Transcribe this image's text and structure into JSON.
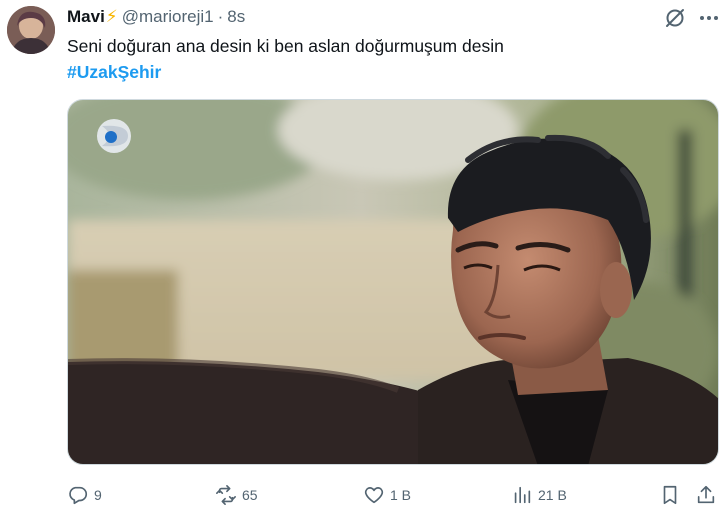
{
  "tweet": {
    "display_name": "Mavi",
    "name_emoji": "⚡",
    "handle": "@marioreji1",
    "separator": "·",
    "time": "8s",
    "text": "Seni doğuran ana desin ki ben aslan doğurmuşum desin",
    "hashtag": "#UzakŞehir"
  },
  "actions": {
    "reply_count": "9",
    "retweet_count": "65",
    "like_count": "1 B",
    "views_count": "21 B"
  },
  "icons": {
    "reply": "reply-icon",
    "retweet": "retweet-icon",
    "like": "heart-icon",
    "views": "views-chart-icon",
    "bookmark": "bookmark-icon",
    "share": "share-icon",
    "grok": "grok-icon",
    "more": "more-icon"
  },
  "colors": {
    "accent": "#1d9bf0",
    "muted": "#536471",
    "text": "#0f1419"
  }
}
